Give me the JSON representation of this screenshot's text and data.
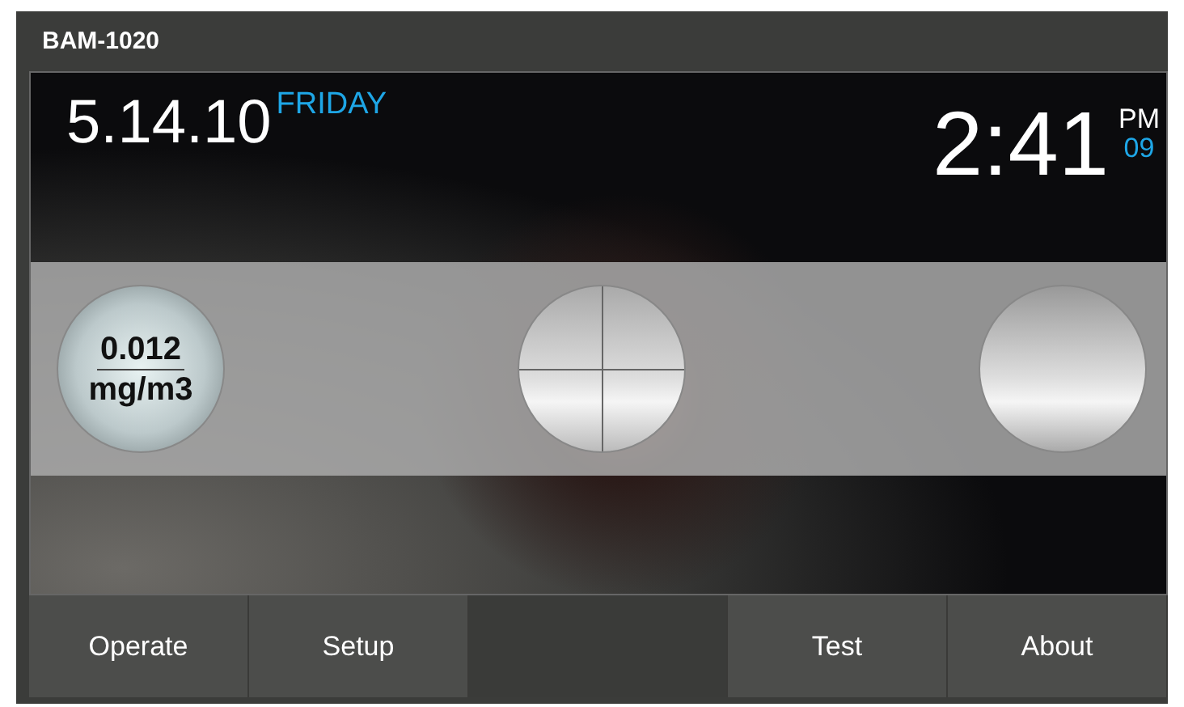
{
  "window": {
    "title": "BAM-1020"
  },
  "clock": {
    "date": "5.14.10",
    "weekday": "FRIDAY",
    "time": "2:41",
    "meridiem": "PM",
    "seconds": "09"
  },
  "gauges": [
    {
      "kind": "reading",
      "value": "0.012",
      "unit": "mg/m3"
    },
    {
      "kind": "crosshair"
    },
    {
      "kind": "blank"
    }
  ],
  "nav": [
    {
      "kind": "button",
      "label": "Operate"
    },
    {
      "kind": "button",
      "label": "Setup"
    },
    {
      "kind": "blank"
    },
    {
      "kind": "button",
      "label": "Test"
    },
    {
      "kind": "button",
      "label": "About"
    }
  ]
}
